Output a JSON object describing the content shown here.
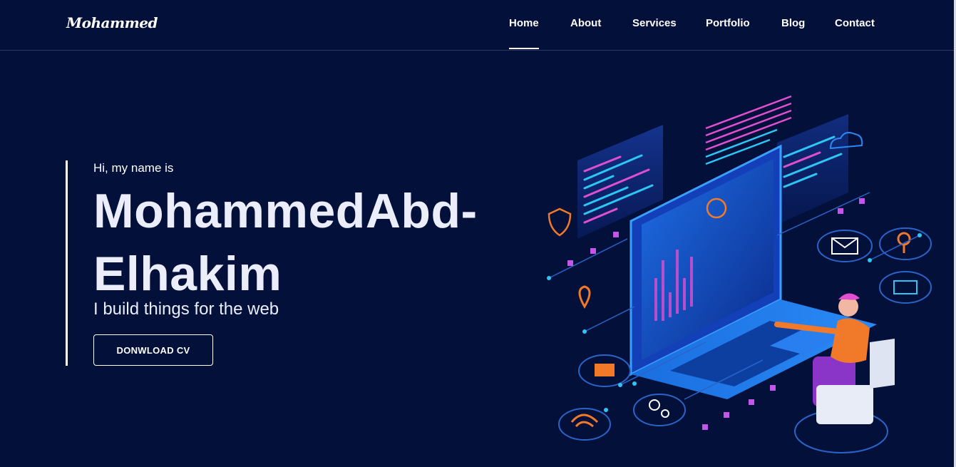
{
  "nav": {
    "logo": "Mohammed",
    "links": [
      {
        "label": "Home",
        "active": true
      },
      {
        "label": "About"
      },
      {
        "label": "Services"
      },
      {
        "label": "Portfolio"
      },
      {
        "label": "Blog"
      },
      {
        "label": "Contact"
      }
    ]
  },
  "hero": {
    "greeting": "Hi, my name is",
    "name": "MohammedAbd-Elhakim",
    "tagline": "I build things for the web",
    "cta_label": "DONWLOAD CV"
  },
  "colors": {
    "background": "#02103a",
    "text": "#ffffff",
    "accent_cyan": "#2ec6f5",
    "accent_pink": "#e04fd0",
    "accent_orange": "#f07a2a"
  }
}
